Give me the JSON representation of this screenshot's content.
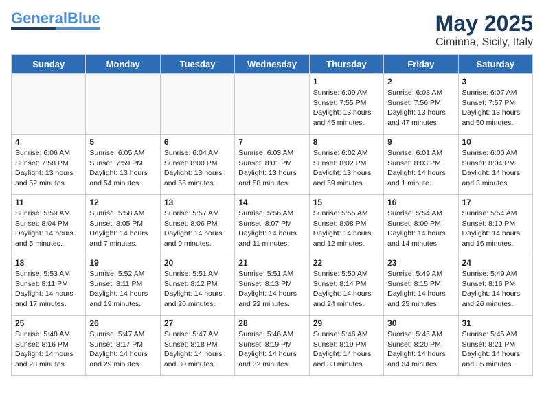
{
  "logo": {
    "general": "General",
    "blue": "Blue"
  },
  "title": "May 2025",
  "location": "Ciminna, Sicily, Italy",
  "days_of_week": [
    "Sunday",
    "Monday",
    "Tuesday",
    "Wednesday",
    "Thursday",
    "Friday",
    "Saturday"
  ],
  "weeks": [
    [
      {
        "day": "",
        "info": "",
        "empty": true
      },
      {
        "day": "",
        "info": "",
        "empty": true
      },
      {
        "day": "",
        "info": "",
        "empty": true
      },
      {
        "day": "",
        "info": "",
        "empty": true
      },
      {
        "day": "1",
        "info": "Sunrise: 6:09 AM\nSunset: 7:55 PM\nDaylight: 13 hours\nand 45 minutes."
      },
      {
        "day": "2",
        "info": "Sunrise: 6:08 AM\nSunset: 7:56 PM\nDaylight: 13 hours\nand 47 minutes."
      },
      {
        "day": "3",
        "info": "Sunrise: 6:07 AM\nSunset: 7:57 PM\nDaylight: 13 hours\nand 50 minutes."
      }
    ],
    [
      {
        "day": "4",
        "info": "Sunrise: 6:06 AM\nSunset: 7:58 PM\nDaylight: 13 hours\nand 52 minutes."
      },
      {
        "day": "5",
        "info": "Sunrise: 6:05 AM\nSunset: 7:59 PM\nDaylight: 13 hours\nand 54 minutes."
      },
      {
        "day": "6",
        "info": "Sunrise: 6:04 AM\nSunset: 8:00 PM\nDaylight: 13 hours\nand 56 minutes."
      },
      {
        "day": "7",
        "info": "Sunrise: 6:03 AM\nSunset: 8:01 PM\nDaylight: 13 hours\nand 58 minutes."
      },
      {
        "day": "8",
        "info": "Sunrise: 6:02 AM\nSunset: 8:02 PM\nDaylight: 13 hours\nand 59 minutes."
      },
      {
        "day": "9",
        "info": "Sunrise: 6:01 AM\nSunset: 8:03 PM\nDaylight: 14 hours\nand 1 minute."
      },
      {
        "day": "10",
        "info": "Sunrise: 6:00 AM\nSunset: 8:04 PM\nDaylight: 14 hours\nand 3 minutes."
      }
    ],
    [
      {
        "day": "11",
        "info": "Sunrise: 5:59 AM\nSunset: 8:04 PM\nDaylight: 14 hours\nand 5 minutes."
      },
      {
        "day": "12",
        "info": "Sunrise: 5:58 AM\nSunset: 8:05 PM\nDaylight: 14 hours\nand 7 minutes."
      },
      {
        "day": "13",
        "info": "Sunrise: 5:57 AM\nSunset: 8:06 PM\nDaylight: 14 hours\nand 9 minutes."
      },
      {
        "day": "14",
        "info": "Sunrise: 5:56 AM\nSunset: 8:07 PM\nDaylight: 14 hours\nand 11 minutes."
      },
      {
        "day": "15",
        "info": "Sunrise: 5:55 AM\nSunset: 8:08 PM\nDaylight: 14 hours\nand 12 minutes."
      },
      {
        "day": "16",
        "info": "Sunrise: 5:54 AM\nSunset: 8:09 PM\nDaylight: 14 hours\nand 14 minutes."
      },
      {
        "day": "17",
        "info": "Sunrise: 5:54 AM\nSunset: 8:10 PM\nDaylight: 14 hours\nand 16 minutes."
      }
    ],
    [
      {
        "day": "18",
        "info": "Sunrise: 5:53 AM\nSunset: 8:11 PM\nDaylight: 14 hours\nand 17 minutes."
      },
      {
        "day": "19",
        "info": "Sunrise: 5:52 AM\nSunset: 8:11 PM\nDaylight: 14 hours\nand 19 minutes."
      },
      {
        "day": "20",
        "info": "Sunrise: 5:51 AM\nSunset: 8:12 PM\nDaylight: 14 hours\nand 20 minutes."
      },
      {
        "day": "21",
        "info": "Sunrise: 5:51 AM\nSunset: 8:13 PM\nDaylight: 14 hours\nand 22 minutes."
      },
      {
        "day": "22",
        "info": "Sunrise: 5:50 AM\nSunset: 8:14 PM\nDaylight: 14 hours\nand 24 minutes."
      },
      {
        "day": "23",
        "info": "Sunrise: 5:49 AM\nSunset: 8:15 PM\nDaylight: 14 hours\nand 25 minutes."
      },
      {
        "day": "24",
        "info": "Sunrise: 5:49 AM\nSunset: 8:16 PM\nDaylight: 14 hours\nand 26 minutes."
      }
    ],
    [
      {
        "day": "25",
        "info": "Sunrise: 5:48 AM\nSunset: 8:16 PM\nDaylight: 14 hours\nand 28 minutes."
      },
      {
        "day": "26",
        "info": "Sunrise: 5:47 AM\nSunset: 8:17 PM\nDaylight: 14 hours\nand 29 minutes."
      },
      {
        "day": "27",
        "info": "Sunrise: 5:47 AM\nSunset: 8:18 PM\nDaylight: 14 hours\nand 30 minutes."
      },
      {
        "day": "28",
        "info": "Sunrise: 5:46 AM\nSunset: 8:19 PM\nDaylight: 14 hours\nand 32 minutes."
      },
      {
        "day": "29",
        "info": "Sunrise: 5:46 AM\nSunset: 8:19 PM\nDaylight: 14 hours\nand 33 minutes."
      },
      {
        "day": "30",
        "info": "Sunrise: 5:46 AM\nSunset: 8:20 PM\nDaylight: 14 hours\nand 34 minutes."
      },
      {
        "day": "31",
        "info": "Sunrise: 5:45 AM\nSunset: 8:21 PM\nDaylight: 14 hours\nand 35 minutes."
      }
    ]
  ]
}
